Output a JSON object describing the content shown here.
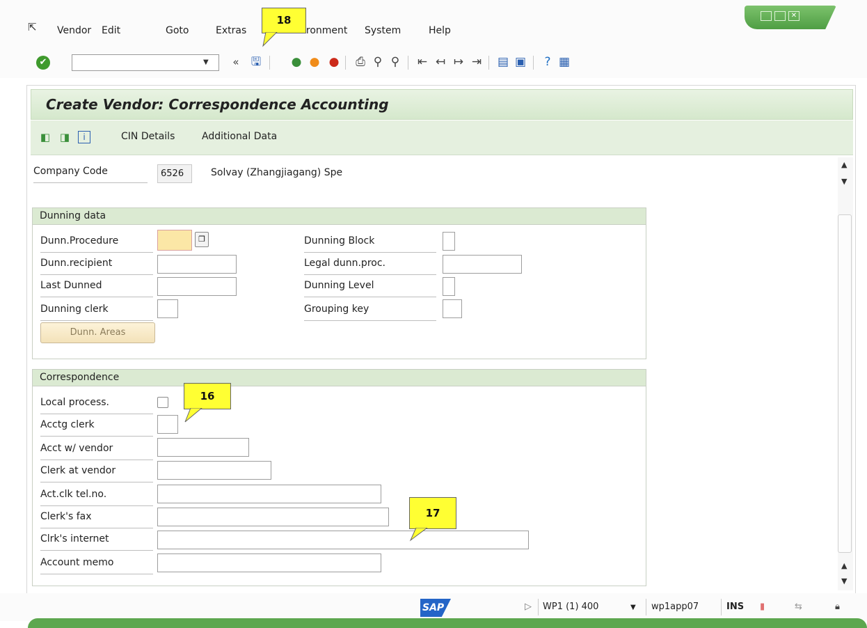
{
  "menu": {
    "items": [
      "Vendor",
      "Edit",
      "Goto",
      "Extras",
      "Environment",
      "System",
      "Help"
    ],
    "underline_chars": [
      "e",
      "E",
      "G",
      "a",
      "n",
      "y",
      "H"
    ]
  },
  "toolbar": {
    "command_field_value": "",
    "icons": [
      "ok-icon",
      "back-arrows-icon",
      "save-icon",
      "back-icon",
      "exit-icon",
      "cancel-icon",
      "print-icon",
      "find-icon",
      "find-next-icon",
      "first-page-icon",
      "previous-page-icon",
      "next-page-icon",
      "last-page-icon",
      "create-session-icon",
      "shortcut-icon",
      "help-icon",
      "customize-icon"
    ]
  },
  "window": {
    "title": "Create Vendor: Correspondence Accounting"
  },
  "app_toolbar": {
    "cin_details": "CIN Details",
    "additional_data": "Additional Data"
  },
  "company_code": {
    "label": "Company Code",
    "value": "6526",
    "name": "Solvay (Zhangjiagang) Spe"
  },
  "dunning": {
    "title": "Dunning data",
    "dunn_procedure": "Dunn.Procedure",
    "dunn_recipient": "Dunn.recipient",
    "last_dunned": "Last Dunned",
    "dunning_clerk": "Dunning clerk",
    "dunning_block": "Dunning Block",
    "legal_dunn_proc": "Legal dunn.proc.",
    "dunning_level": "Dunning Level",
    "grouping_key": "Grouping key",
    "areas_button": "Dunn. Areas"
  },
  "correspondence": {
    "title": "Correspondence",
    "local_process": "Local process.",
    "acctg_clerk": "Acctg clerk",
    "acct_w_vendor": "Acct w/ vendor",
    "clerk_at_vendor": "Clerk at vendor",
    "act_clk_tel": "Act.clk tel.no.",
    "clerks_fax": "Clerk's fax",
    "clrks_internet": "Clrk's internet",
    "account_memo": "Account memo"
  },
  "callouts": {
    "c16": "16",
    "c17": "17",
    "c18": "18"
  },
  "status": {
    "logo": "SAP",
    "system": "WP1 (1) 400",
    "server": "wp1app07",
    "mode": "INS"
  },
  "colors": {
    "title_bg": "#dbead2",
    "accent_green": "#5da74f",
    "callout": "#ffff33"
  }
}
